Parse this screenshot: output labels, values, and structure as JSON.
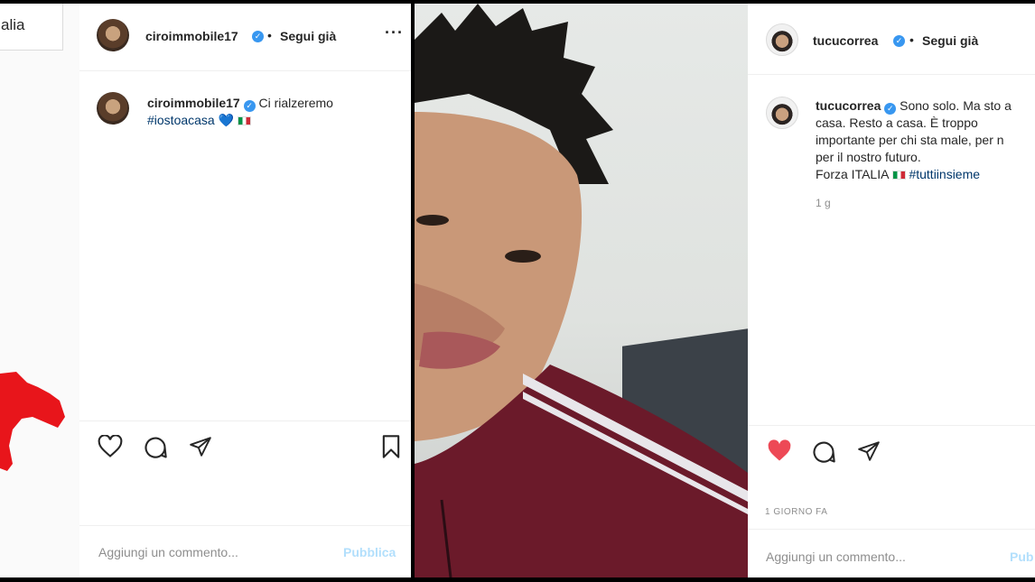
{
  "left_fragment": {
    "tab_text": "alia"
  },
  "post1": {
    "header": {
      "username": "ciroimmobile17",
      "follow_status": "Segui già",
      "more_icon": "more-horizontal-icon"
    },
    "caption": {
      "username": "ciroimmobile17",
      "text": "Ci rialzeremo",
      "hashtag": "#iostoacasa",
      "emoji": "💙"
    },
    "actions": [
      "heart-icon",
      "comment-icon",
      "share-icon",
      "bookmark-icon"
    ],
    "comment": {
      "placeholder": "Aggiungi un commento...",
      "publish": "Pubblica"
    }
  },
  "post2": {
    "top_text": "",
    "header": {
      "username": "tucucorrea",
      "follow_status": "Segui già"
    },
    "caption": {
      "username": "tucucorrea",
      "text": "Sono solo. Ma sto a casa. Resto a casa. È troppo importante per chi sta male, per noi, per il nostro futuro.",
      "line1": "Sono solo. Ma sto a",
      "line2": "casa. Resto a casa. È troppo",
      "line3": "importante per chi sta male, per n",
      "line4": "per il nostro futuro.",
      "line5_text": "Forza ITALIA",
      "hashtag": "#tuttiinsieme",
      "time": "1 g"
    },
    "actions": [
      "heart-filled-icon",
      "comment-icon",
      "share-icon"
    ],
    "heart_color": "#ed4956",
    "date": "1 GIORNO FA",
    "comment": {
      "placeholder": "Aggiungi un commento...",
      "publish": "Pub"
    }
  },
  "colors": {
    "link": "#00376b",
    "verified": "#3897f0",
    "publish": "#b2dffc"
  }
}
